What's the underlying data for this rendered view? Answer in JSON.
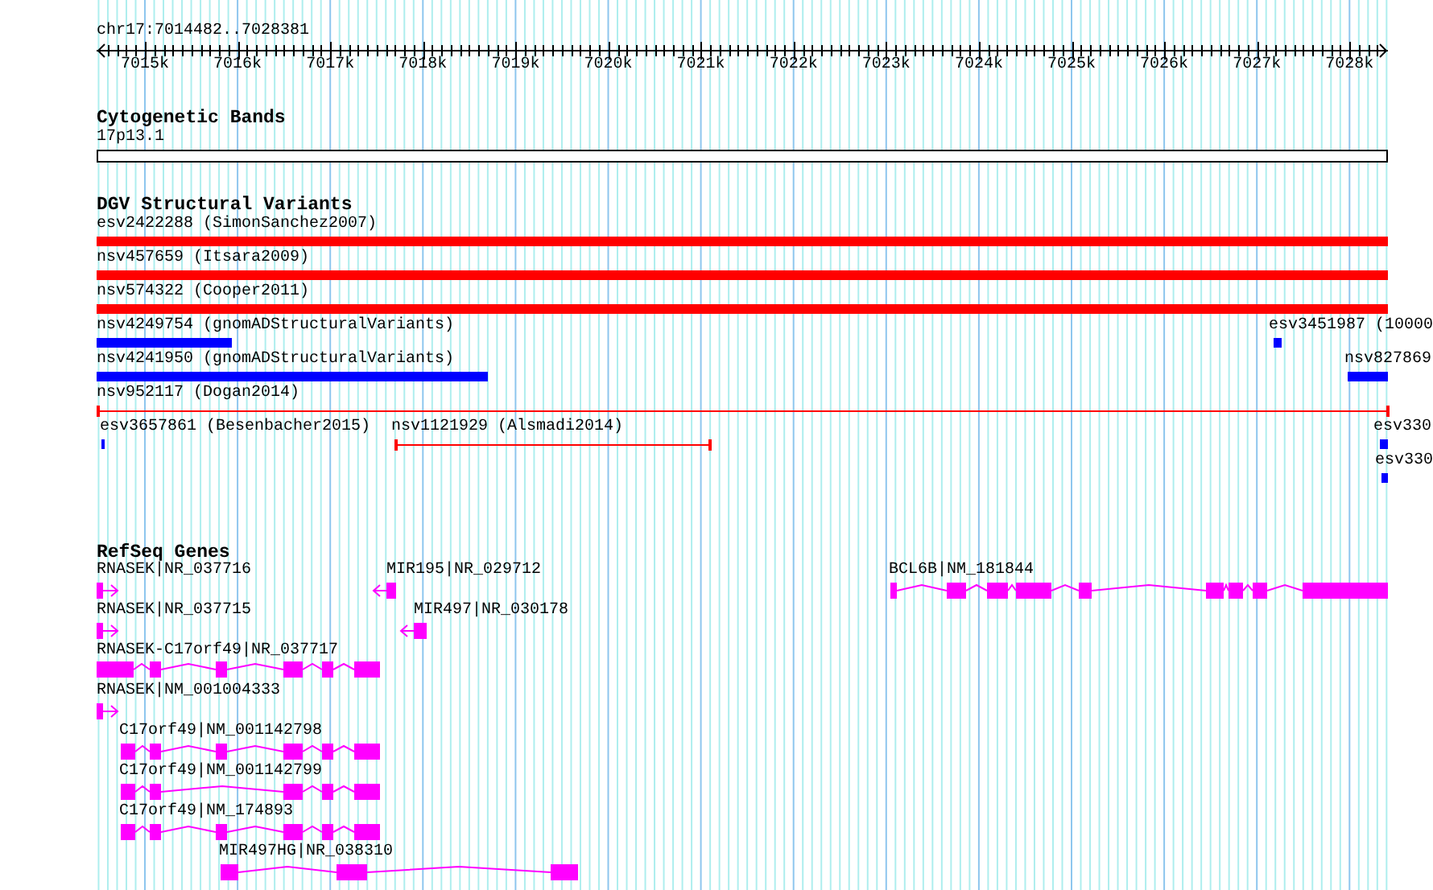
{
  "ruler": {
    "position": "chr17:7014482..7028381",
    "ticks": [
      "7015k",
      "7016k",
      "7017k",
      "7018k",
      "7019k",
      "7020k",
      "7021k",
      "7022k",
      "7023k",
      "7024k",
      "7025k",
      "7026k",
      "7027k",
      "7028k"
    ]
  },
  "tracks": [
    {
      "title": "Cytogenetic Bands",
      "kind": "bands",
      "features": [
        {
          "label": "17p13.1"
        }
      ]
    },
    {
      "title": "DGV Structural Variants",
      "kind": "variants",
      "features": [
        {
          "label": "esv2422288 (SimonSanchez2007)",
          "kind": "bar",
          "color": "#ff0000"
        },
        {
          "label": "nsv457659 (Itsara2009)",
          "kind": "bar",
          "color": "#ff0000"
        },
        {
          "label": "nsv574322 (Cooper2011)",
          "kind": "bar",
          "color": "#ff0000"
        },
        {
          "label": "nsv4249754 (gnomADStructuralVariants)",
          "kind": "bar",
          "color": "#0000ff"
        },
        {
          "label": "esv3451987 (10000",
          "kind": "bar",
          "color": "#0000ff"
        },
        {
          "label": "nsv4241950 (gnomADStructuralVariants)",
          "kind": "bar",
          "color": "#0000ff"
        },
        {
          "label": "nsv827869",
          "kind": "bar",
          "color": "#0000ff"
        },
        {
          "label": "nsv952117 (Dogan2014)",
          "kind": "line",
          "color": "#ff0000"
        },
        {
          "label": "esv3657861 (Besenbacher2015)",
          "kind": "bar",
          "color": "#0000ff"
        },
        {
          "label": "nsv1121929 (Alsmadi2014)",
          "kind": "line",
          "color": "#ff0000"
        },
        {
          "label": "esv330",
          "kind": "bar",
          "color": "#0000ff"
        },
        {
          "label": "esv330",
          "kind": "bar",
          "color": "#0000ff"
        }
      ]
    },
    {
      "title": "RefSeq Genes",
      "kind": "genes",
      "features": [
        {
          "label": "RNASEK|NR_037716",
          "kind": "forward"
        },
        {
          "label": "MIR195|NR_029712",
          "kind": "reverse"
        },
        {
          "label": "BCL6B|NM_181844",
          "kind": "spliced"
        },
        {
          "label": "RNASEK|NR_037715",
          "kind": "forward"
        },
        {
          "label": "MIR497|NR_030178",
          "kind": "reverse"
        },
        {
          "label": "RNASEK-C17orf49|NR_037717",
          "kind": "spliced"
        },
        {
          "label": "RNASEK|NM_001004333",
          "kind": "forward"
        },
        {
          "label": "C17orf49|NM_001142798",
          "kind": "spliced"
        },
        {
          "label": "C17orf49|NM_001142799",
          "kind": "spliced"
        },
        {
          "label": "C17orf49|NM_174893",
          "kind": "spliced"
        },
        {
          "label": "MIR497HG|NR_038310",
          "kind": "spliced"
        }
      ]
    }
  ]
}
